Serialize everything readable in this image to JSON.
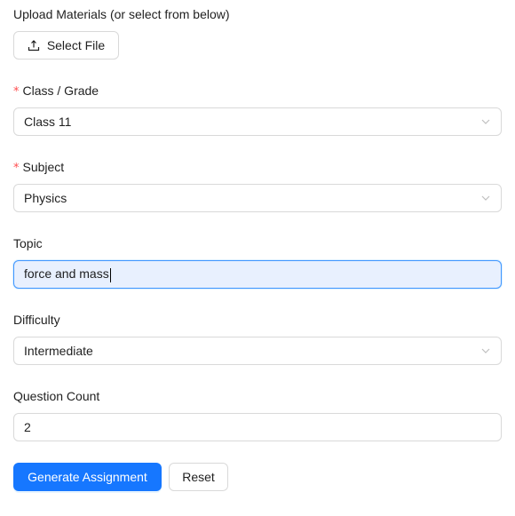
{
  "upload": {
    "label": "Upload Materials (or select from below)",
    "button_label": "Select File",
    "icon": "upload-icon"
  },
  "class_grade": {
    "label": "Class / Grade",
    "required_mark": "*",
    "value": "Class 11",
    "icon": "chevron-down-icon"
  },
  "subject": {
    "label": "Subject",
    "required_mark": "*",
    "value": "Physics",
    "icon": "chevron-down-icon"
  },
  "topic": {
    "label": "Topic",
    "value": "force and mass"
  },
  "difficulty": {
    "label": "Difficulty",
    "value": "Intermediate",
    "icon": "chevron-down-icon"
  },
  "question_count": {
    "label": "Question Count",
    "value": "2"
  },
  "actions": {
    "generate_label": "Generate Assignment",
    "reset_label": "Reset"
  },
  "colors": {
    "primary": "#1677ff",
    "required": "#ff4d4f",
    "border": "#d9d9d9",
    "focus_border": "#4096ff",
    "focus_bg": "#e8f0fe"
  }
}
